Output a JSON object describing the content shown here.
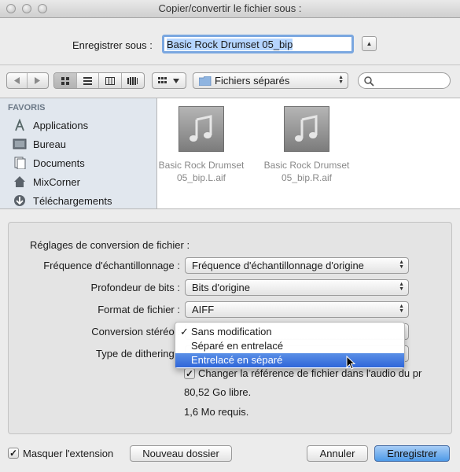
{
  "window": {
    "title": "Copier/convertir le fichier sous :"
  },
  "save": {
    "label": "Enregistrer sous :",
    "value": "Basic Rock Drumset 05_bip"
  },
  "toolbar": {
    "location": "Fichiers séparés",
    "search_placeholder": ""
  },
  "sidebar": {
    "heading": "FAVORIS",
    "items": [
      {
        "label": "Applications",
        "icon": "applications-icon"
      },
      {
        "label": "Bureau",
        "icon": "desktop-icon"
      },
      {
        "label": "Documents",
        "icon": "documents-icon"
      },
      {
        "label": "MixCorner",
        "icon": "home-icon"
      },
      {
        "label": "Téléchargements",
        "icon": "downloads-icon"
      }
    ]
  },
  "files": [
    {
      "line1": "Basic Rock Drumset",
      "line2": "05_bip.L.aif"
    },
    {
      "line1": "Basic Rock Drumset",
      "line2": "05_bip.R.aif"
    }
  ],
  "options": {
    "title": "Réglages de conversion de fichier :",
    "sample_rate": {
      "label": "Fréquence d'échantillonnage :",
      "value": "Fréquence d'échantillonnage d'origine"
    },
    "bit_depth": {
      "label": "Profondeur de bits :",
      "value": "Bits d'origine"
    },
    "file_format": {
      "label": "Format de fichier :",
      "value": "AIFF"
    },
    "stereo": {
      "label": "Conversion stéréo :"
    },
    "dither": {
      "label": "Type de dithering :"
    },
    "stereo_menu": [
      {
        "label": "Sans modification",
        "checked": true
      },
      {
        "label": "Séparé en entrelacé",
        "checked": false
      },
      {
        "label": "Entrelacé en séparé",
        "checked": false
      }
    ],
    "change_ref": "Changer la référence de fichier dans l'audio du pr",
    "free_space": "80,52 Go libre.",
    "required": "1,6 Mo requis."
  },
  "footer": {
    "hide_extension": "Masquer l'extension",
    "new_folder": "Nouveau dossier",
    "cancel": "Annuler",
    "save": "Enregistrer"
  }
}
